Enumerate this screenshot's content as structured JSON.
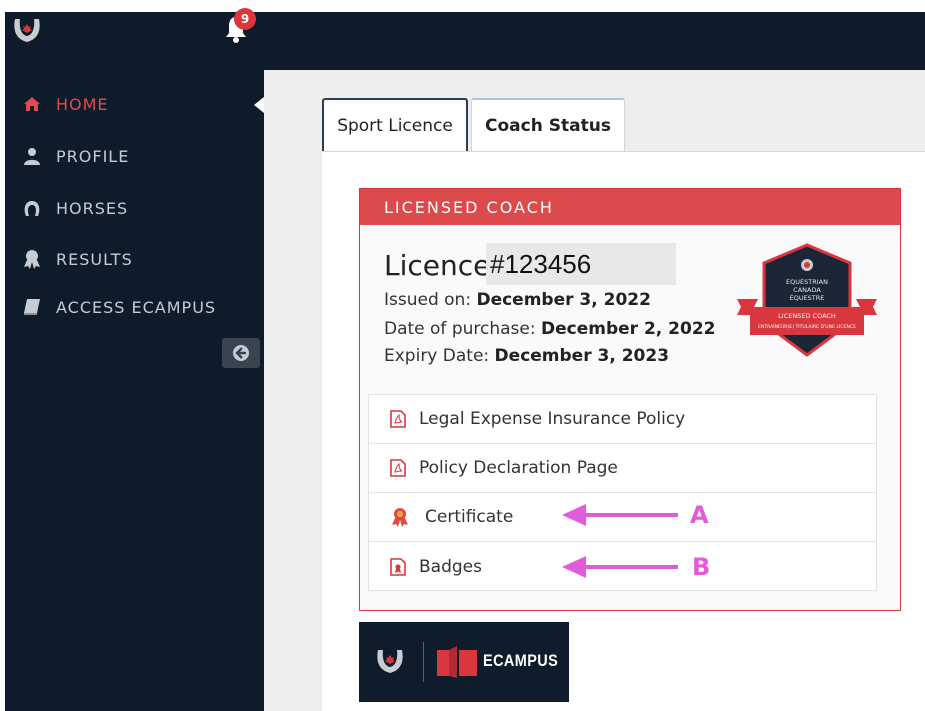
{
  "topbar": {
    "notification_count": "9"
  },
  "sidebar": {
    "items": [
      {
        "label": "HOME",
        "icon": "home-icon",
        "active": true
      },
      {
        "label": "PROFILE",
        "icon": "user-icon",
        "active": false
      },
      {
        "label": "HORSES",
        "icon": "horseshoe-icon",
        "active": false
      },
      {
        "label": "RESULTS",
        "icon": "ribbon-icon",
        "active": false
      },
      {
        "label": "ACCESS ECAMPUS",
        "icon": "book-icon",
        "active": false
      }
    ],
    "collapse_icon": "arrow-left-circle-icon"
  },
  "tabs": [
    {
      "label": "Sport Licence",
      "selected": false
    },
    {
      "label": "Coach Status",
      "selected": true
    }
  ],
  "card": {
    "header": "LICENSED COACH",
    "licence_label": "Licence",
    "licence_number": "#123456",
    "issued_label": "Issued on:",
    "issued_value": "December 3, 2022",
    "purchase_label": "Date of purchase:",
    "purchase_value": "December 2, 2022",
    "expiry_label": "Expiry Date:",
    "expiry_value": "December 3, 2023",
    "crest_text": [
      "EQUESTRIAN",
      "CANADA",
      "ÉQUESTRE",
      "LICENSED COACH",
      "ENTRAÎNEUR(E) TITULAIRE D'UNE LICENCE"
    ]
  },
  "documents": [
    {
      "label": "Legal Expense Insurance Policy",
      "icon": "pdf-icon"
    },
    {
      "label": "Policy Declaration Page",
      "icon": "pdf-icon"
    },
    {
      "label": "Certificate",
      "icon": "award-icon"
    },
    {
      "label": "Badges",
      "icon": "badge-file-icon"
    }
  ],
  "annotations": [
    {
      "letter": "A",
      "target": "Certificate"
    },
    {
      "letter": "B",
      "target": "Badges"
    }
  ],
  "ecampus_banner": {
    "label": "ECAMPUS"
  },
  "colors": {
    "navy": "#0d1b2a",
    "accent_red": "#dd4a4b",
    "annotation_pink": "#e05cd8"
  }
}
